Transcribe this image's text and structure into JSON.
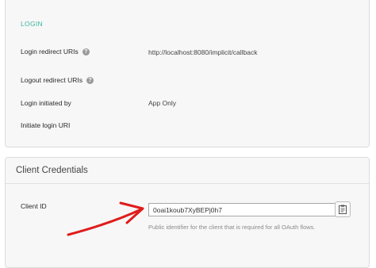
{
  "login_section": {
    "title": "LOGIN",
    "rows": [
      {
        "label": "Login redirect URIs",
        "value": "http://localhost:8080/implicit/callback",
        "help": true
      },
      {
        "label": "Logout redirect URIs",
        "value": "",
        "help": true
      },
      {
        "label": "Login initiated by",
        "value": "App Only",
        "help": false
      },
      {
        "label": "Initiate login URI",
        "value": "",
        "help": false
      }
    ]
  },
  "client_credentials": {
    "title": "Client Credentials",
    "client_id_label": "Client ID",
    "client_id_value": "0oai1koub7XyBEPj0h7",
    "client_id_help": "Public identifier for the client that is required for all OAuth flows.",
    "copy_icon": "clipboard-icon"
  },
  "colors": {
    "accent": "#3cb4a0",
    "annotation_arrow": "#e01b1b"
  }
}
